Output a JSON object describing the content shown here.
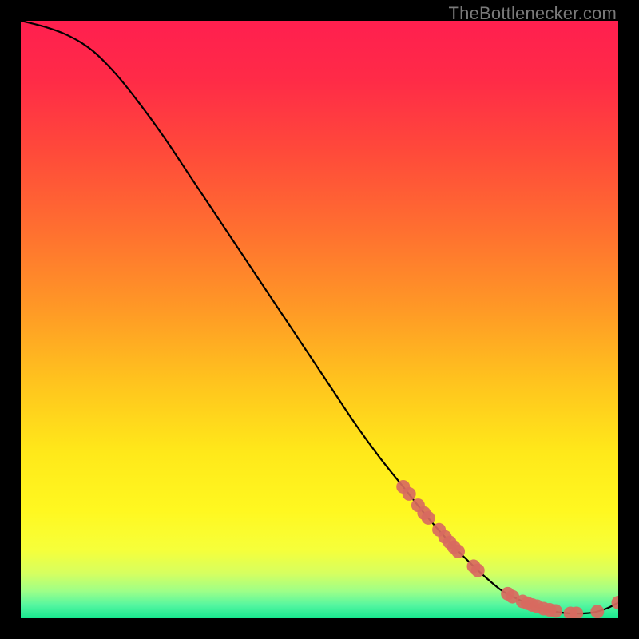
{
  "watermark": "TheBottlenecker.com",
  "chart_data": {
    "type": "line",
    "title": "",
    "xlabel": "",
    "ylabel": "",
    "xlim": [
      0,
      100
    ],
    "ylim": [
      0,
      100
    ],
    "series": [
      {
        "name": "curve",
        "x": [
          0,
          4,
          8,
          12,
          16,
          20,
          24,
          28,
          32,
          36,
          40,
          44,
          48,
          52,
          56,
          60,
          64,
          68,
          72,
          76,
          80,
          82,
          84,
          86,
          88,
          90,
          92,
          94,
          96,
          98,
          100
        ],
        "y": [
          100,
          99,
          97.5,
          95,
          91,
          86,
          80.5,
          74.5,
          68.5,
          62.5,
          56.5,
          50.5,
          44.5,
          38.5,
          32.5,
          27,
          22,
          17,
          12.5,
          8.5,
          5,
          3.8,
          2.8,
          2.0,
          1.4,
          1.0,
          0.8,
          0.8,
          1.0,
          1.6,
          2.6
        ]
      }
    ],
    "markers": [
      {
        "x": 64.0,
        "y": 22.0
      },
      {
        "x": 65.0,
        "y": 20.8
      },
      {
        "x": 66.5,
        "y": 18.9
      },
      {
        "x": 67.5,
        "y": 17.6
      },
      {
        "x": 68.2,
        "y": 16.8
      },
      {
        "x": 70.0,
        "y": 14.8
      },
      {
        "x": 71.0,
        "y": 13.6
      },
      {
        "x": 71.8,
        "y": 12.7
      },
      {
        "x": 72.5,
        "y": 11.9
      },
      {
        "x": 73.2,
        "y": 11.2
      },
      {
        "x": 75.8,
        "y": 8.7
      },
      {
        "x": 76.5,
        "y": 8.0
      },
      {
        "x": 81.5,
        "y": 4.1
      },
      {
        "x": 82.3,
        "y": 3.6
      },
      {
        "x": 84.0,
        "y": 2.8
      },
      {
        "x": 84.8,
        "y": 2.5
      },
      {
        "x": 85.6,
        "y": 2.2
      },
      {
        "x": 86.4,
        "y": 2.0
      },
      {
        "x": 87.5,
        "y": 1.6
      },
      {
        "x": 88.5,
        "y": 1.4
      },
      {
        "x": 89.5,
        "y": 1.2
      },
      {
        "x": 92.0,
        "y": 0.8
      },
      {
        "x": 93.0,
        "y": 0.8
      },
      {
        "x": 96.5,
        "y": 1.1
      },
      {
        "x": 100.0,
        "y": 2.6
      }
    ],
    "gradient_stops": [
      {
        "offset": 0.0,
        "color": "#ff1f4f"
      },
      {
        "offset": 0.1,
        "color": "#ff2b47"
      },
      {
        "offset": 0.22,
        "color": "#ff4a3a"
      },
      {
        "offset": 0.35,
        "color": "#ff6f30"
      },
      {
        "offset": 0.48,
        "color": "#ff9826"
      },
      {
        "offset": 0.6,
        "color": "#ffc21e"
      },
      {
        "offset": 0.72,
        "color": "#ffe81a"
      },
      {
        "offset": 0.82,
        "color": "#fff820"
      },
      {
        "offset": 0.885,
        "color": "#f6ff3a"
      },
      {
        "offset": 0.925,
        "color": "#d6ff60"
      },
      {
        "offset": 0.955,
        "color": "#9dff88"
      },
      {
        "offset": 0.978,
        "color": "#55f6a0"
      },
      {
        "offset": 1.0,
        "color": "#18e88f"
      }
    ],
    "marker_color": "#d86a5f",
    "curve_color": "#000000"
  }
}
